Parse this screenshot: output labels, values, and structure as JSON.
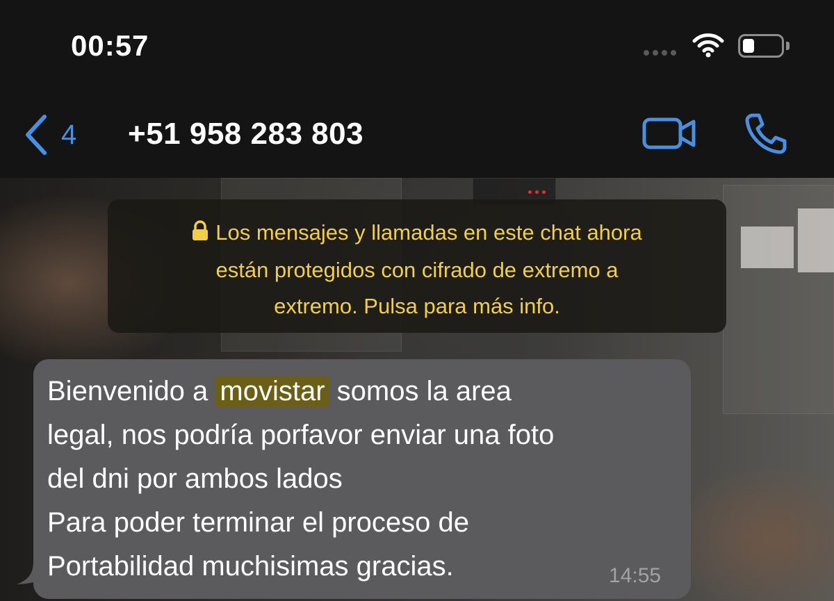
{
  "status_bar": {
    "time": "00:57",
    "battery_level": 0.3
  },
  "nav": {
    "back_count": "4",
    "contact": "+51 958 283 803",
    "accent_color": "#4a90e2"
  },
  "notice": {
    "line1": "Los mensajes y llamadas en este chat ahora",
    "line2": "están protegidos con cifrado de extremo a",
    "line3": "extremo. Pulsa para más info.",
    "color": "#f2cf4a"
  },
  "message": {
    "line1_before": "Bienvenido a ",
    "line1_highlight": "movistar",
    "line1_after": " somos la area",
    "line2": "legal, nos podría porfavor enviar una foto",
    "line3": "del dni por ambos lados",
    "line4": "Para poder terminar el proceso de",
    "line5": "Portabilidad muchisimas gracias.",
    "time": "14:55"
  },
  "icons": {
    "back": "chevron-left-icon",
    "video": "video-camera-icon",
    "call": "phone-icon",
    "lock": "lock-icon",
    "wifi": "wifi-icon",
    "battery": "battery-icon",
    "signal": "signal-dots-icon"
  }
}
